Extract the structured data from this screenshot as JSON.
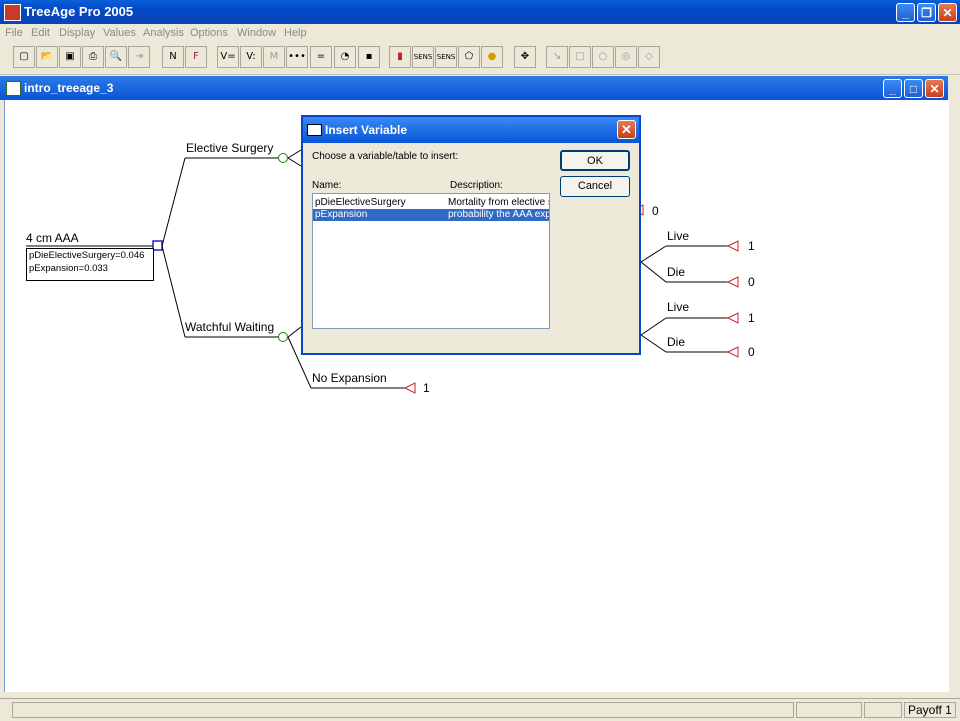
{
  "app": {
    "title": "TreeAge Pro 2005"
  },
  "menu": [
    "File",
    "Edit",
    "Display",
    "Values",
    "Analysis",
    "Options",
    "Window",
    "Help"
  ],
  "toolbar": [
    "new-icon",
    "open-icon",
    "save-icon",
    "print-icon",
    "print-preview-icon",
    "export-icon",
    "node-name-icon",
    "formula-icon",
    "variable-define-icon",
    "variable-property-icon",
    "markov-icon",
    "more-icon",
    "equals-icon",
    "clock-icon",
    "cluster-icon",
    "bar-chart-icon",
    "sens-icon",
    "sens2-icon",
    "shape-icon",
    "color-icon",
    "move-icon",
    "arrow-icon",
    "square-icon",
    "circle-icon",
    "circle2-icon",
    "diamond-icon"
  ],
  "document": {
    "title": "intro_treeage_3"
  },
  "tree": {
    "root_label": "4 cm AAA",
    "root_vars": [
      "pDieElectiveSurgery=0.046",
      "pExpansion=0.033"
    ],
    "branch_elective": "Elective Surgery",
    "branch_watchful": "Watchful Waiting",
    "branch_no_expansion": "No Expansion",
    "payoff_no_expansion": "1",
    "payoff_hidden_top": "0",
    "live1": "Live",
    "payoff_live1": "1",
    "die1": "Die",
    "payoff_die1": "0",
    "live2": "Live",
    "payoff_live2": "1",
    "die2": "Die",
    "payoff_die2": "0"
  },
  "dialog": {
    "title": "Insert Variable",
    "prompt": "Choose a variable/table to insert:",
    "col_name": "Name:",
    "col_desc": "Description:",
    "rows": [
      {
        "name": "pDieElectiveSurgery",
        "desc": "Mortality from elective s"
      },
      {
        "name": "pExpansion",
        "desc": "probability the AAA exp"
      }
    ],
    "ok": "OK",
    "cancel": "Cancel"
  },
  "status": {
    "payoff": "Payoff 1"
  }
}
